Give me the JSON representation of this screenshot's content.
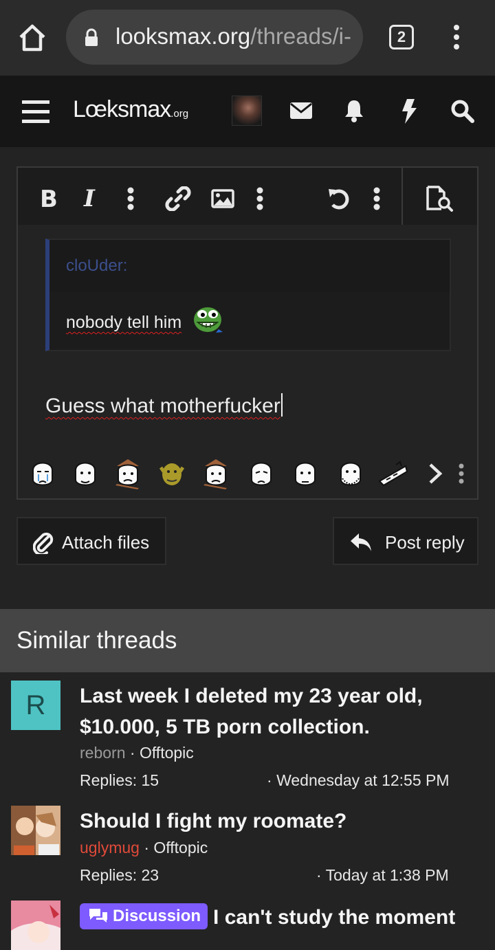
{
  "browser": {
    "url_host": "looksmax.org",
    "url_path": "/threads/i-",
    "tab_count": "2"
  },
  "site": {
    "logo_main": "Lœksmax",
    "logo_suffix": ".org"
  },
  "editor": {
    "quote_author": "cloUder:",
    "quote_text": "nobody tell him",
    "body_text": "Guess what motherfucker"
  },
  "actions": {
    "attach_label": "Attach files",
    "post_label": "Post reply"
  },
  "similar": {
    "heading": "Similar threads",
    "threads": [
      {
        "avatar_letter": "R",
        "title": "Last week I deleted my 23 year old, $10.000, 5 TB porn collection.",
        "author": "reborn",
        "forum": "Offtopic",
        "replies": "Replies: 15",
        "date": "Wednesday at 12:55 PM"
      },
      {
        "title": "Should I fight my roomate?",
        "author": "uglymug",
        "forum": "Offtopic",
        "replies": "Replies: 23",
        "date": "Today at 1:38 PM"
      },
      {
        "badge": "Discussion",
        "title": "I can't study the moment"
      }
    ]
  },
  "colors": {
    "accent_badge": "#7d5bff",
    "quote_author": "#3b4f8c",
    "username_red": "#e04a3a"
  }
}
